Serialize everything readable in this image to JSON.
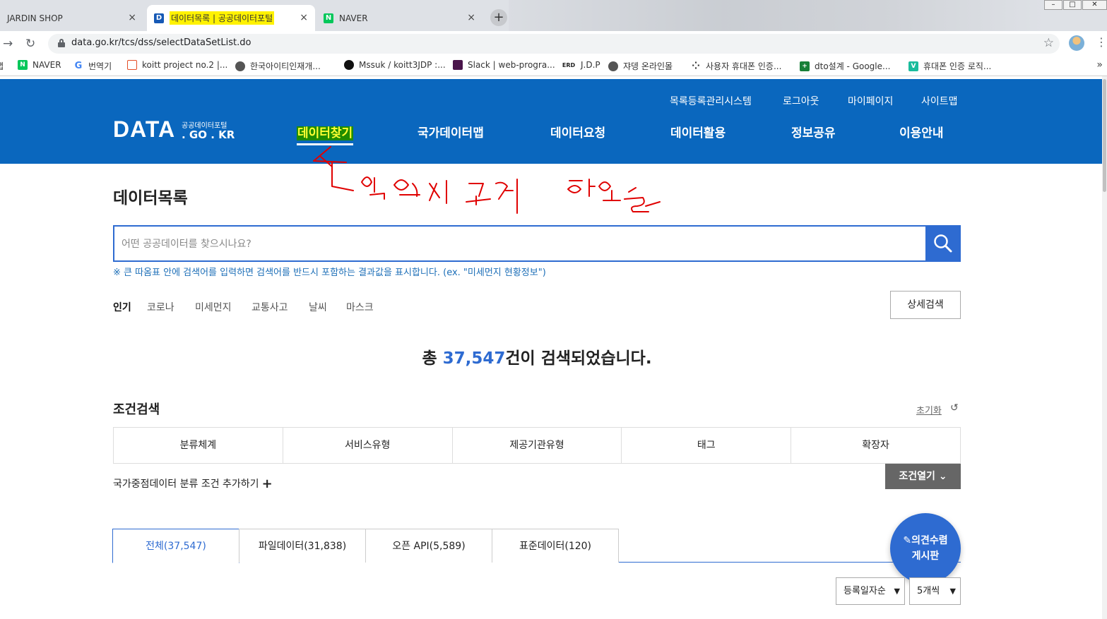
{
  "browser": {
    "tabs": [
      {
        "title": "JARDIN SHOP",
        "close": "×"
      },
      {
        "title": "데이터목록 | 공공데이터포털",
        "close": "×",
        "fav": "D"
      },
      {
        "title": "NAVER",
        "close": "×",
        "fav": "N"
      }
    ],
    "new_tab": "+",
    "url": "data.go.kr/tcs/dss/selectDataSetList.do",
    "bookmarks": [
      {
        "label": "NAVER",
        "fav": "N",
        "color": "#03c75a"
      },
      {
        "label": "번역기",
        "fav": "G",
        "color": "#4285f4"
      },
      {
        "label": "koitt project no.2 |...",
        "fav": "",
        "color": "#e44d26"
      },
      {
        "label": "한국아이티인재개...",
        "fav": "",
        "color": "#555555"
      },
      {
        "label": "Mssuk / koitt3JDP :...",
        "fav": "",
        "color": "#111111"
      },
      {
        "label": "Slack | web-progra...",
        "fav": "",
        "color": "#4a154b"
      },
      {
        "label": "J.D.P",
        "fav": "ERD",
        "color": "#222222"
      },
      {
        "label": "쟈뎅 온라인몰",
        "fav": "",
        "color": "#555555"
      },
      {
        "label": "사용자 휴대폰 인증...",
        "fav": "",
        "color": "#333333"
      },
      {
        "label": "dto설계 - Google...",
        "fav": "+",
        "color": "#188038"
      },
      {
        "label": "휴대폰 인증 로직...",
        "fav": "V",
        "color": "#1abc9c"
      }
    ],
    "bookmarks_more": "»"
  },
  "header": {
    "util_links": [
      "목록등록관리시스템",
      "로그아웃",
      "마이페이지",
      "사이트맵"
    ],
    "logo_main": "DATA",
    "logo_sub": "공공데이터포털",
    "logo_domain": ". GO . KR",
    "nav": [
      "데이터찾기",
      "국가데이터맵",
      "데이터요청",
      "데이터활용",
      "정보공유",
      "이용안내"
    ]
  },
  "page": {
    "title": "데이터목록",
    "search_placeholder": "어떤 공공데이터를 찾으시나요?",
    "search_hint": "※ 큰 따옴표 안에 검색어를 입력하면 검색어를 반드시 포함하는 결과값을 표시합니다. (ex. \"미세먼지 현황정보\")",
    "popular_label": "인기",
    "popular": [
      "코로나",
      "미세먼지",
      "교통사고",
      "날씨",
      "마스크"
    ],
    "detail_search": "상세검색",
    "result_prefix": "총 ",
    "result_count": "37,547",
    "result_suffix": "건이 검색되었습니다.",
    "cond_title": "조건검색",
    "reset": "초기화",
    "conditions": [
      "분류체계",
      "서비스유형",
      "제공기관유형",
      "태그",
      "확장자"
    ],
    "add_condition": "국가중점데이터 분류 조건 추가하기",
    "open_conditions": "조건열기",
    "data_tabs": [
      "전체(37,547)",
      "파일데이터(31,838)",
      "오픈 API(5,589)",
      "표준데이터(120)"
    ],
    "feedback_line1": "의견수렴",
    "feedback_line2": "게시판",
    "sort_select": "등록일자순",
    "page_size_select": "5개씩"
  },
  "colors": {
    "header_blue": "#0a67be",
    "accent_blue": "#2e6bd1",
    "active_nav_bg": "#1f8c00",
    "active_nav_text": "#ffff33",
    "annotation": "#e00000"
  }
}
